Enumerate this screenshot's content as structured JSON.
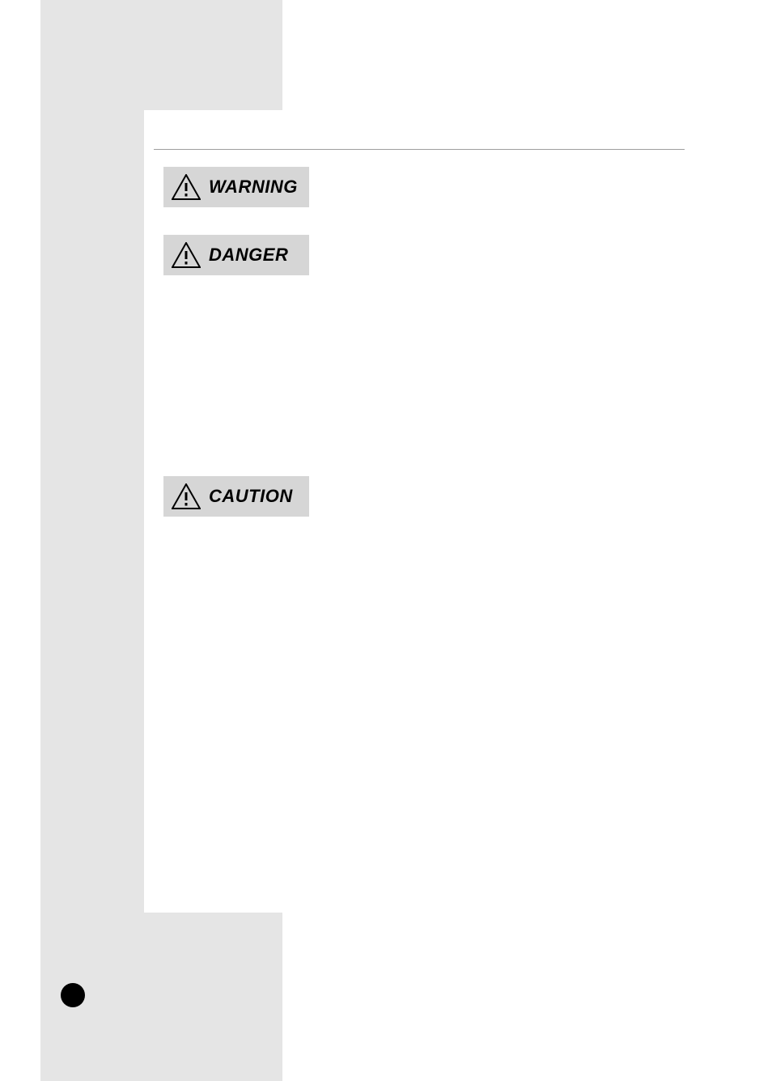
{
  "alerts": {
    "warning": {
      "label": "WARNING"
    },
    "danger": {
      "label": "DANGER"
    },
    "caution": {
      "label": "CAUTION"
    }
  }
}
